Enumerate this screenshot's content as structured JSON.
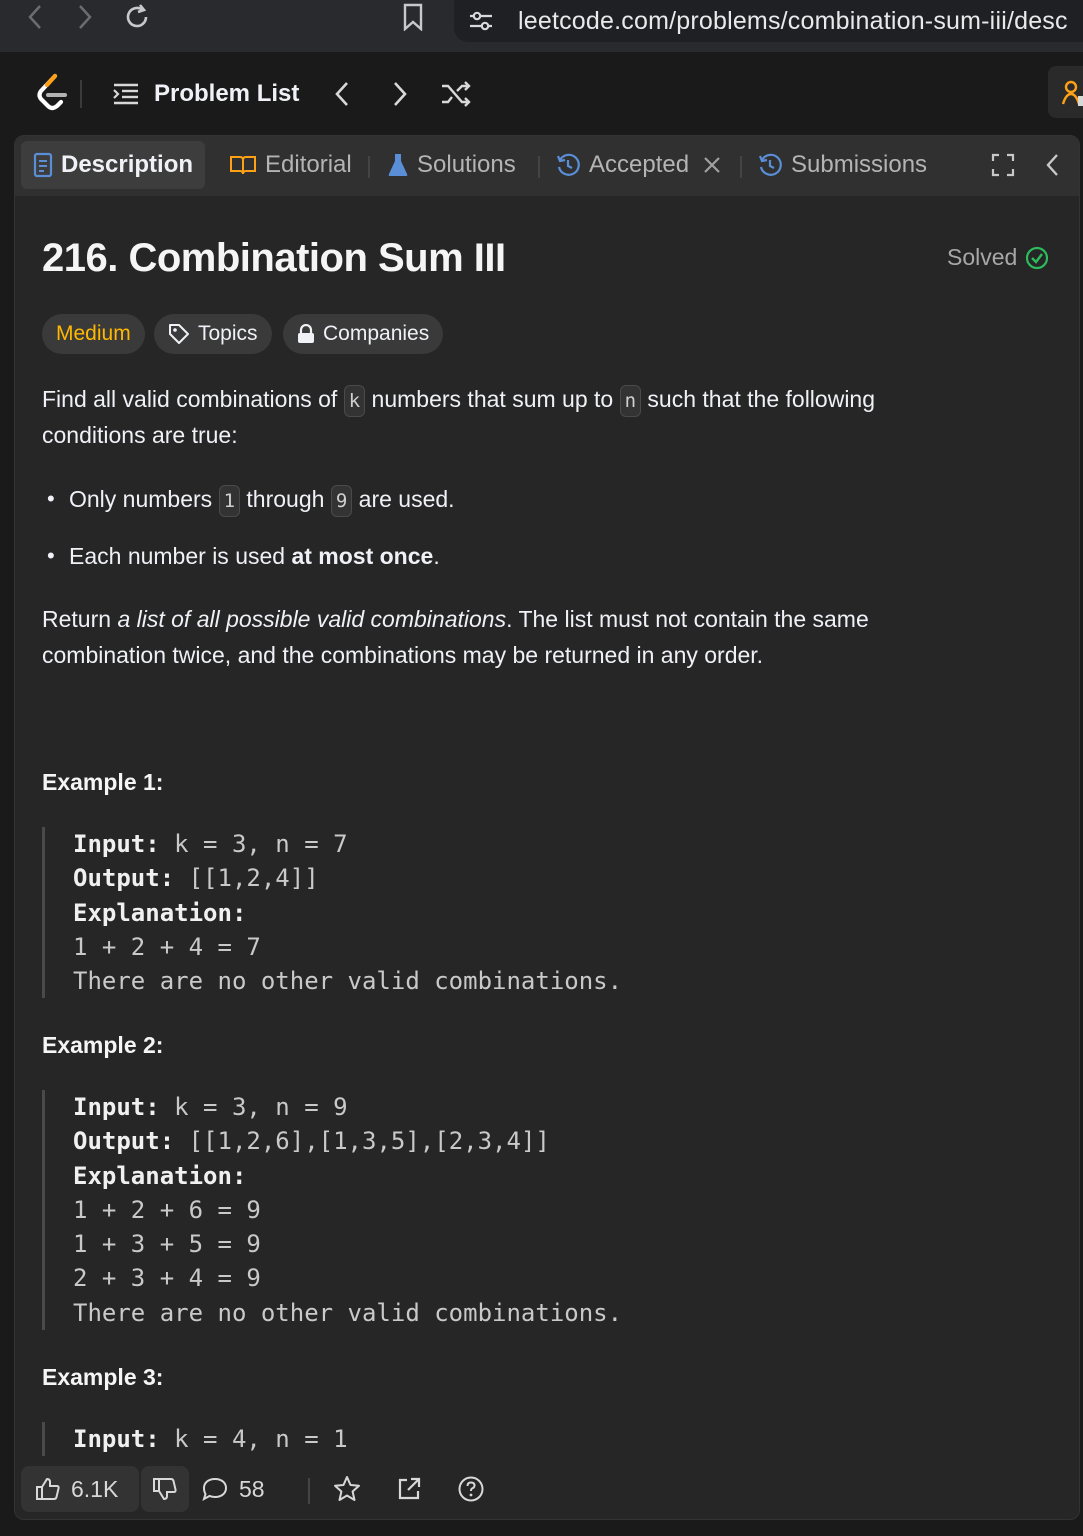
{
  "browser": {
    "url": "leetcode.com/problems/combination-sum-iii/desc"
  },
  "nav": {
    "problem_list": "Problem List"
  },
  "tabs": {
    "description": "Description",
    "editorial": "Editorial",
    "solutions": "Solutions",
    "accepted": "Accepted",
    "submissions": "Submissions"
  },
  "problem": {
    "title": "216. Combination Sum III",
    "status": "Solved",
    "difficulty": "Medium",
    "topics": "Topics",
    "companies": "Companies"
  },
  "description": {
    "p1_a": "Find all valid combinations of ",
    "p1_k": "k",
    "p1_b": " numbers that sum up to ",
    "p1_n": "n",
    "p1_c": " such that the following",
    "p1_d": "conditions are true:",
    "b1_a": "Only numbers ",
    "b1_1": "1",
    "b1_b": " through ",
    "b1_9": "9",
    "b1_c": " are used.",
    "b2_a": "Each number is used ",
    "b2_b": "at most once",
    "b2_c": ".",
    "p2_a": "Return ",
    "p2_b": "a list of all possible valid combinations",
    "p2_c": ". The list must not contain the same",
    "p2_d": "combination twice, and the combinations may be returned in any order."
  },
  "examples": [
    {
      "title": "Example 1:",
      "input_label": "Input:",
      "input": " k = 3, n = 7",
      "output_label": "Output:",
      "output": " [[1,2,4]]",
      "explanation_label": "Explanation:",
      "lines": [
        "1 + 2 + 4 = 7",
        "There are no other valid combinations."
      ]
    },
    {
      "title": "Example 2:",
      "input_label": "Input:",
      "input": " k = 3, n = 9",
      "output_label": "Output:",
      "output": " [[1,2,6],[1,3,5],[2,3,4]]",
      "explanation_label": "Explanation:",
      "lines": [
        "1 + 2 + 6 = 9",
        "1 + 3 + 5 = 9",
        "2 + 3 + 4 = 9",
        "There are no other valid combinations."
      ]
    },
    {
      "title": "Example 3:",
      "input_label": "Input:",
      "input": " k = 4, n = 1"
    }
  ],
  "bottom": {
    "likes": "6.1K",
    "comments": "58"
  },
  "colors": {
    "medium": "#ffb800",
    "solved_check": "#2cbb5d",
    "tab_icon_blue": "#5a8fd8",
    "logo_orange": "#ffa116"
  },
  "icons": [
    "back-icon",
    "forward-icon",
    "reload-icon",
    "bookmark-icon",
    "site-settings-icon",
    "leetcode-logo",
    "list-icon",
    "chevron-left-icon",
    "chevron-right-icon",
    "shuffle-icon",
    "description-icon",
    "book-icon",
    "flask-icon",
    "history-icon",
    "close-icon",
    "expand-icon",
    "collapse-icon",
    "check-circle-icon",
    "tag-icon",
    "lock-icon",
    "thumbs-up-icon",
    "thumbs-down-icon",
    "comment-icon",
    "star-icon",
    "share-icon",
    "help-icon"
  ]
}
